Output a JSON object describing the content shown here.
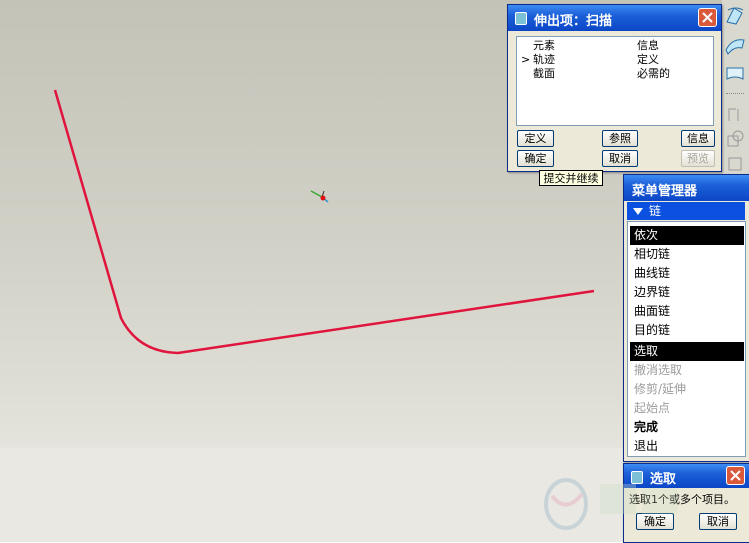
{
  "sweep_dialog": {
    "title": "伸出项：扫描",
    "columns": [
      "元素",
      "信息"
    ],
    "rows": [
      {
        "marker": ">",
        "element": "轨迹",
        "info": "定义"
      },
      {
        "marker": "",
        "element": "截面",
        "info": "必需的"
      }
    ],
    "buttons": {
      "define": "定义",
      "refs": "参照",
      "info": "信息",
      "ok": "确定",
      "cancel": "取消",
      "preview": "预览"
    },
    "tooltip": "提交并继续"
  },
  "menu_manager": {
    "title": "菜单管理器",
    "section": "链",
    "chain_items": [
      {
        "label": "依次",
        "state": "selected"
      },
      {
        "label": "相切链",
        "state": "normal"
      },
      {
        "label": "曲线链",
        "state": "normal"
      },
      {
        "label": "边界链",
        "state": "normal"
      },
      {
        "label": "曲面链",
        "state": "normal"
      },
      {
        "label": "目的链",
        "state": "normal"
      }
    ],
    "action_items": [
      {
        "label": "选取",
        "state": "selected"
      },
      {
        "label": "撤消选取",
        "state": "disabled"
      },
      {
        "label": "修剪/延伸",
        "state": "disabled"
      },
      {
        "label": "起始点",
        "state": "disabled"
      },
      {
        "label": "完成",
        "state": "bold"
      },
      {
        "label": "退出",
        "state": "normal"
      }
    ]
  },
  "select_dialog": {
    "title": "选取",
    "message": "选取1个或多个项目。",
    "ok": "确定",
    "cancel": "取消"
  },
  "icons": [
    "close-icon",
    "sweep-icon",
    "surface-icon",
    "boundary-icon",
    "down-triangle-icon",
    "csys-icon"
  ],
  "colors": {
    "curve": "#e0143c",
    "title_bar": "#0b46c7",
    "menu_selected": "#000000"
  }
}
